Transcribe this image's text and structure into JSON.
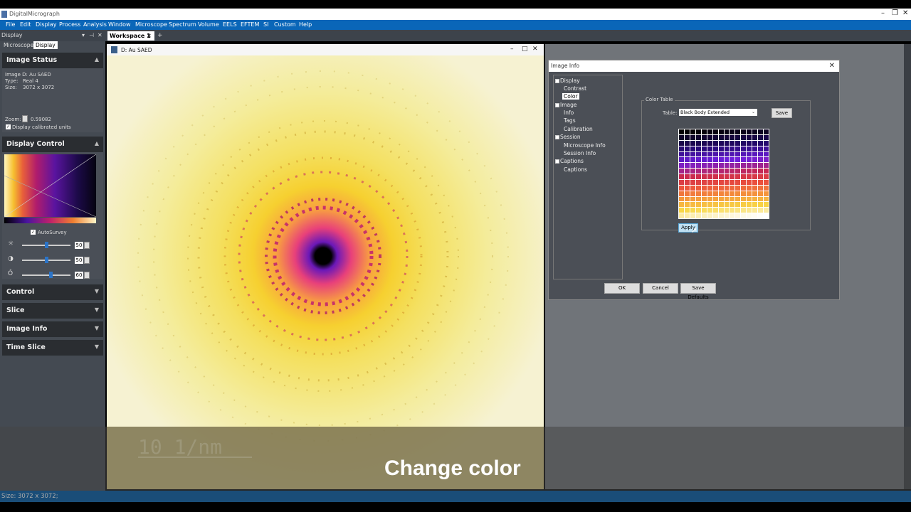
{
  "app": {
    "title": "DigitalMicrograph"
  },
  "menu": [
    "File",
    "Edit",
    "Display",
    "Process",
    "Analysis",
    "Window",
    "Microscope",
    "Spectrum",
    "Volume",
    "EELS",
    "EFTEM",
    "SI",
    "Custom",
    "Help"
  ],
  "dock": {
    "title": "Display",
    "subtabs": [
      "Microscope",
      "Display"
    ]
  },
  "workspace_tab": {
    "label": "Workspace 1",
    "close": "✕",
    "add": "+"
  },
  "image_status": {
    "header": "Image Status",
    "line1": "Image D: Au SAED",
    "type_label": "Type:",
    "type_value": "Real 4",
    "size_label": "Size:",
    "size_value": "3072 x 3072",
    "zoom_label": "Zoom:",
    "zoom_value": "0.59082",
    "calibrated_label": "Display calibrated units"
  },
  "display_control": {
    "header": "Display Control",
    "autosurvey_label": "AutoSurvey",
    "brightness": {
      "icon": "brightness-icon",
      "value": "50",
      "level": 50
    },
    "contrast": {
      "icon": "contrast-icon",
      "value": "50",
      "level": 50
    },
    "gamma": {
      "icon": "gamma-icon",
      "value": "60",
      "level": 60
    }
  },
  "collapsed_panels": [
    "Control",
    "Slice",
    "Image Info",
    "Time Slice"
  ],
  "image_window": {
    "title": "D: Au SAED"
  },
  "dialog": {
    "title": "Image Info",
    "tree": {
      "display": "Display",
      "contrast": "Contrast",
      "color": "Color",
      "image": "Image",
      "info": "Info",
      "tags": "Tags",
      "calibration": "Calibration",
      "session": "Session",
      "microscope_info": "Microscope Info",
      "session_info": "Session Info",
      "captions": "Captions",
      "captions_child": "Captions"
    },
    "color_table_label": "Color Table",
    "table_label": "Table:",
    "table_value": "Black Body Extended",
    "save_label": "Save",
    "apply_label": "Apply",
    "ok_label": "OK",
    "cancel_label": "Cancel",
    "save_defaults_label": "Save Defaults"
  },
  "overlay": {
    "caption": "Change color",
    "scalebar": "10 1/nm"
  },
  "status": {
    "text": "Size: 3072 x 3072;"
  }
}
